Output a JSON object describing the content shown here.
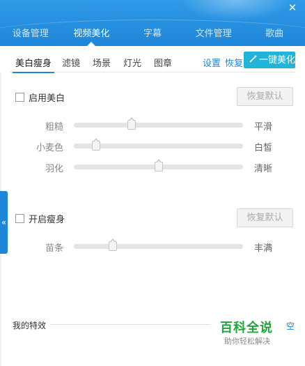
{
  "window": {
    "close_label": "✕"
  },
  "top_tabs": [
    {
      "label": "设备管理",
      "active": false
    },
    {
      "label": "视频美化",
      "active": true
    },
    {
      "label": "字幕",
      "active": false
    },
    {
      "label": "文件管理",
      "active": false
    },
    {
      "label": "歌曲",
      "active": false
    }
  ],
  "sub_tabs": [
    {
      "label": "美白瘦身",
      "active": true
    },
    {
      "label": "滤镜",
      "active": false
    },
    {
      "label": "场景",
      "active": false
    },
    {
      "label": "灯光",
      "active": false
    },
    {
      "label": "图章",
      "active": false
    }
  ],
  "toolbar": {
    "settings_label": "设置",
    "restore_label": "恢复",
    "one_key_label": "一键美化",
    "one_key_icon": "magic-wand-icon",
    "accent_color": "#20b5d8"
  },
  "whitening": {
    "checkbox_label": "启用美白",
    "checked": false,
    "reset_label": "恢复默认",
    "sliders": [
      {
        "left_label": "粗糙",
        "right_label": "平滑",
        "value": 0.34
      },
      {
        "left_label": "小麦色",
        "right_label": "白皙",
        "value": 0.13
      },
      {
        "left_label": "羽化",
        "right_label": "清晰",
        "value": 0.5
      }
    ]
  },
  "slimming": {
    "checkbox_label": "开启瘦身",
    "checked": false,
    "reset_label": "恢复默认",
    "sliders": [
      {
        "left_label": "苗条",
        "right_label": "丰满",
        "value": 0.23
      }
    ]
  },
  "sidebar": {
    "collapse_label": "«"
  },
  "effects": {
    "title": "我的特效",
    "clear_label": "空"
  },
  "watermark": {
    "main": "百科全说",
    "sub": "助你轻松解决"
  },
  "colors": {
    "header": "#1e86d9",
    "link": "#1e86d9",
    "brand": "#1fa53a"
  }
}
